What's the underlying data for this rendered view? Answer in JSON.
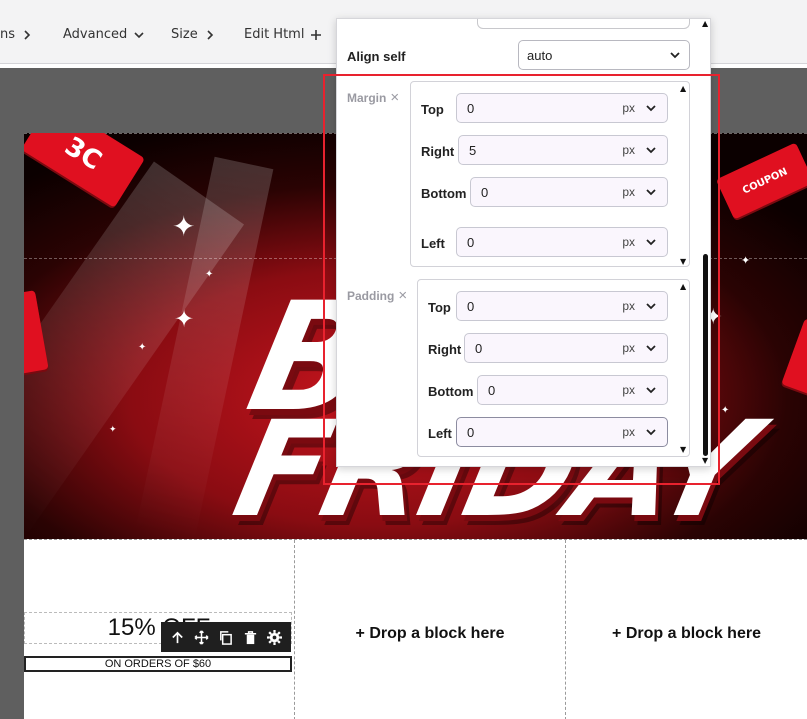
{
  "toolbar": {
    "items": [
      {
        "label": "ns",
        "icon": "chevron-right-icon"
      },
      {
        "label": "Advanced",
        "icon": "chevron-down-icon"
      },
      {
        "label": "Size",
        "icon": "chevron-right-icon"
      },
      {
        "label": "Edit Html",
        "icon": "plus-icon"
      }
    ]
  },
  "style_panel": {
    "align_self": {
      "label": "Align self",
      "value": "auto"
    },
    "margin": {
      "label": "Margin",
      "fields": [
        {
          "label": "Top",
          "value": "0",
          "unit": "px"
        },
        {
          "label": "Right",
          "value": "5",
          "unit": "px"
        },
        {
          "label": "Bottom",
          "value": "0",
          "unit": "px"
        },
        {
          "label": "Left",
          "value": "0",
          "unit": "px"
        }
      ]
    },
    "padding": {
      "label": "Padding",
      "fields": [
        {
          "label": "Top",
          "value": "0",
          "unit": "px"
        },
        {
          "label": "Right",
          "value": "0",
          "unit": "px"
        },
        {
          "label": "Bottom",
          "value": "0",
          "unit": "px"
        },
        {
          "label": "Left",
          "value": "0",
          "unit": "px"
        }
      ]
    }
  },
  "canvas": {
    "banner": {
      "line1": "BL",
      "line2": "FRIDAY",
      "ticket_right": "COUPON"
    },
    "offer": {
      "title": "15% OFF",
      "subtitle": "ON ORDERS OF $60"
    },
    "drop_placeholder": "+ Drop a block here"
  },
  "colors": {
    "accent_red": "#e8222e",
    "banner_red": "#c8141e"
  }
}
